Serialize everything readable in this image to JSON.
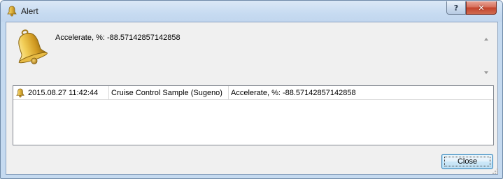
{
  "window": {
    "title": "Alert",
    "title_icon": "bell-icon",
    "help_button_label": "?",
    "close_button_label": "✕"
  },
  "message": {
    "icon": "bell-icon",
    "text": "Accelerate, %: -88.57142857142858"
  },
  "alerts_list": {
    "rows": [
      {
        "icon": "bell-icon",
        "time": "2015.08.27 11:42:44",
        "source": "Cruise Control Sample (Sugeno)",
        "message": "Accelerate, %: -88.57142857142858"
      }
    ]
  },
  "buttons": {
    "close_label": "Close"
  },
  "colors": {
    "frame": "#c5daf0",
    "client": "#f0f0f0",
    "close_button_border": "#3c7fb1",
    "bell_gold": "#d9a92f"
  }
}
